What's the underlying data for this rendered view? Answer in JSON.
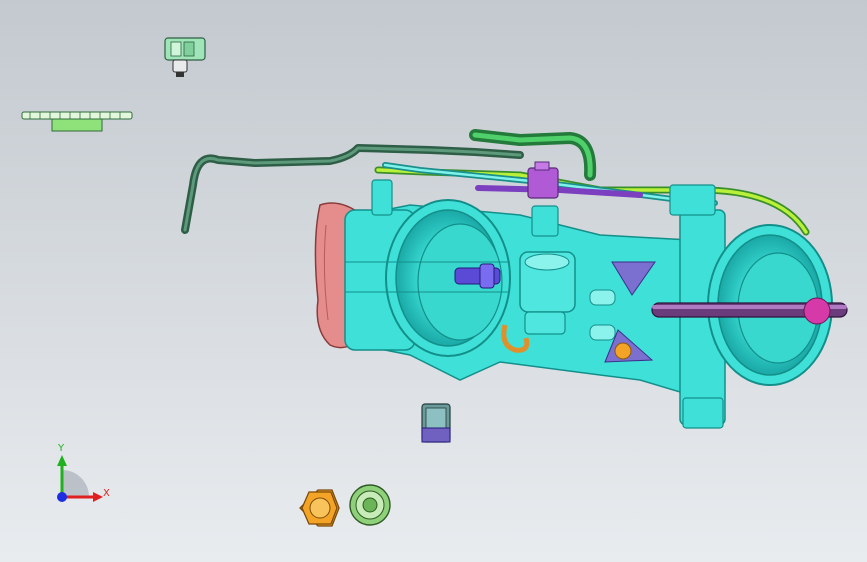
{
  "viewport": {
    "background_top": "#c3c9cf",
    "background_bottom": "#e9ecef",
    "theme": "CAD 3D assembly viewport"
  },
  "colors": {
    "body_cyan": "#3fe0d8",
    "body_cyan_dark": "#1aa8a6",
    "body_cyan_light": "#8cf2ec",
    "gasket_pink": "#e58c8c",
    "hose_green_dark": "#3f7a5c",
    "hose_green": "#27b04b",
    "hose_lime": "#b9f03a",
    "connector_purple": "#b05ad6",
    "rod_violet": "#6b3c7c",
    "cap_magenta": "#d63aa8",
    "nut_orange": "#f3a427",
    "nut_green": "#8fd07a",
    "bolt_blue": "#5a4ad6",
    "spring_orange": "#e0902a"
  },
  "triad": {
    "x_label": "X",
    "y_label": "Y",
    "x_color": "#e02020",
    "y_color": "#20b020",
    "z_color": "#1c2ee0"
  },
  "parts": [
    {
      "icon": "sensor-connector-icon"
    },
    {
      "icon": "gear-icon"
    },
    {
      "icon": "nut-orange-icon"
    },
    {
      "icon": "nut-green-icon"
    },
    {
      "icon": "bushing-icon"
    },
    {
      "icon": "throttle-body-icon"
    }
  ]
}
